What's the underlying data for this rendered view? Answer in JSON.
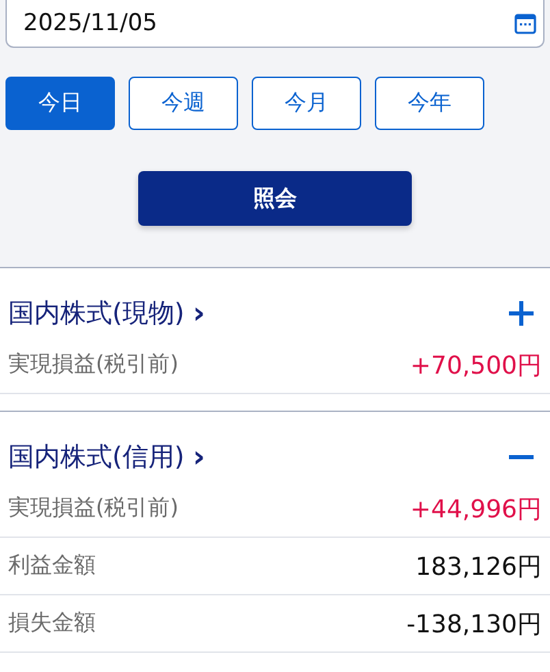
{
  "date_field": {
    "value": "2025/11/05"
  },
  "periods": [
    {
      "label": "今日",
      "selected": true
    },
    {
      "label": "今週",
      "selected": false
    },
    {
      "label": "今月",
      "selected": false
    },
    {
      "label": "今年",
      "selected": false
    }
  ],
  "query_button": "照会",
  "sections": [
    {
      "title": "国内株式(現物)",
      "chevron": "›",
      "expanded": false,
      "rows": [
        {
          "label": "実現損益(税引前)",
          "value": "+70,500円",
          "kind": "gain"
        }
      ]
    },
    {
      "title": "国内株式(信用)",
      "chevron": "›",
      "expanded": true,
      "rows": [
        {
          "label": "実現損益(税引前)",
          "value": "+44,996円",
          "kind": "gain"
        },
        {
          "label": "利益金額",
          "value": "183,126円",
          "kind": "plain"
        },
        {
          "label": "損失金額",
          "value": "-138,130円",
          "kind": "plain"
        }
      ]
    }
  ]
}
